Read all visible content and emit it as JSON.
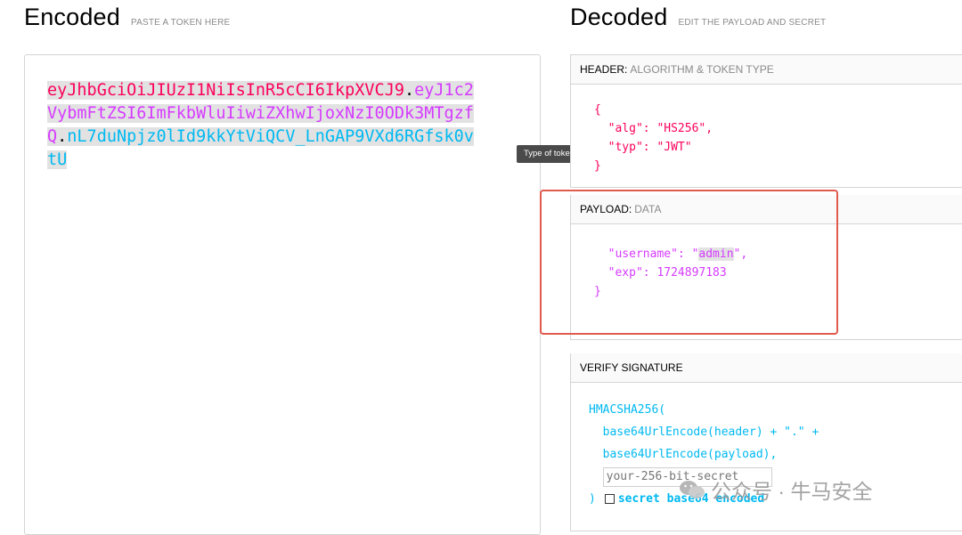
{
  "encoded": {
    "title": "Encoded",
    "subtitle": "PASTE A TOKEN HERE",
    "token": {
      "header": "eyJhbGciOiJIUzI1NiIsInR5cCI6IkpXVCJ9",
      "dot1": ".",
      "payload": "eyJ1c2VybmFtZSI6ImFkbWluIiwiZXhwIjoxNzI0ODk3MTgzfQ",
      "dot2": ".",
      "signature": "nL7duNpjz0lId9kkYtViQCV_LnGAP9VXd6RGfsk0vtU"
    }
  },
  "tooltip": "Type of token",
  "decoded": {
    "title": "Decoded",
    "subtitle": "EDIT THE PAYLOAD AND SECRET",
    "header": {
      "label": "HEADER:",
      "sub": "ALGORITHM & TOKEN TYPE",
      "open": "{",
      "alg_line": "  \"alg\": \"HS256\",",
      "typ_line": "  \"typ\": \"JWT\"",
      "close": "}"
    },
    "payload": {
      "label": "PAYLOAD:",
      "sub": "DATA",
      "username_key": "  \"username\": \"",
      "username_value": "admin",
      "username_end": "\",",
      "exp_line": "  \"exp\": 1724897183",
      "close": "}"
    },
    "verify": {
      "label": "VERIFY SIGNATURE",
      "line1": "HMACSHA256(",
      "line2": "  base64UrlEncode(header) + \".\" +",
      "line3": "  base64UrlEncode(payload),",
      "secret_placeholder": "your-256-bit-secret",
      "close": ")",
      "checkbox_label": "secret base64 encoded"
    }
  },
  "watermark": {
    "text": "公众号 · 牛马安全",
    "icon": "wechat-icon"
  },
  "colors": {
    "header": "#fb015b",
    "payload": "#d63aff",
    "signature": "#00b9f1",
    "highlight": "#e05a4e"
  }
}
